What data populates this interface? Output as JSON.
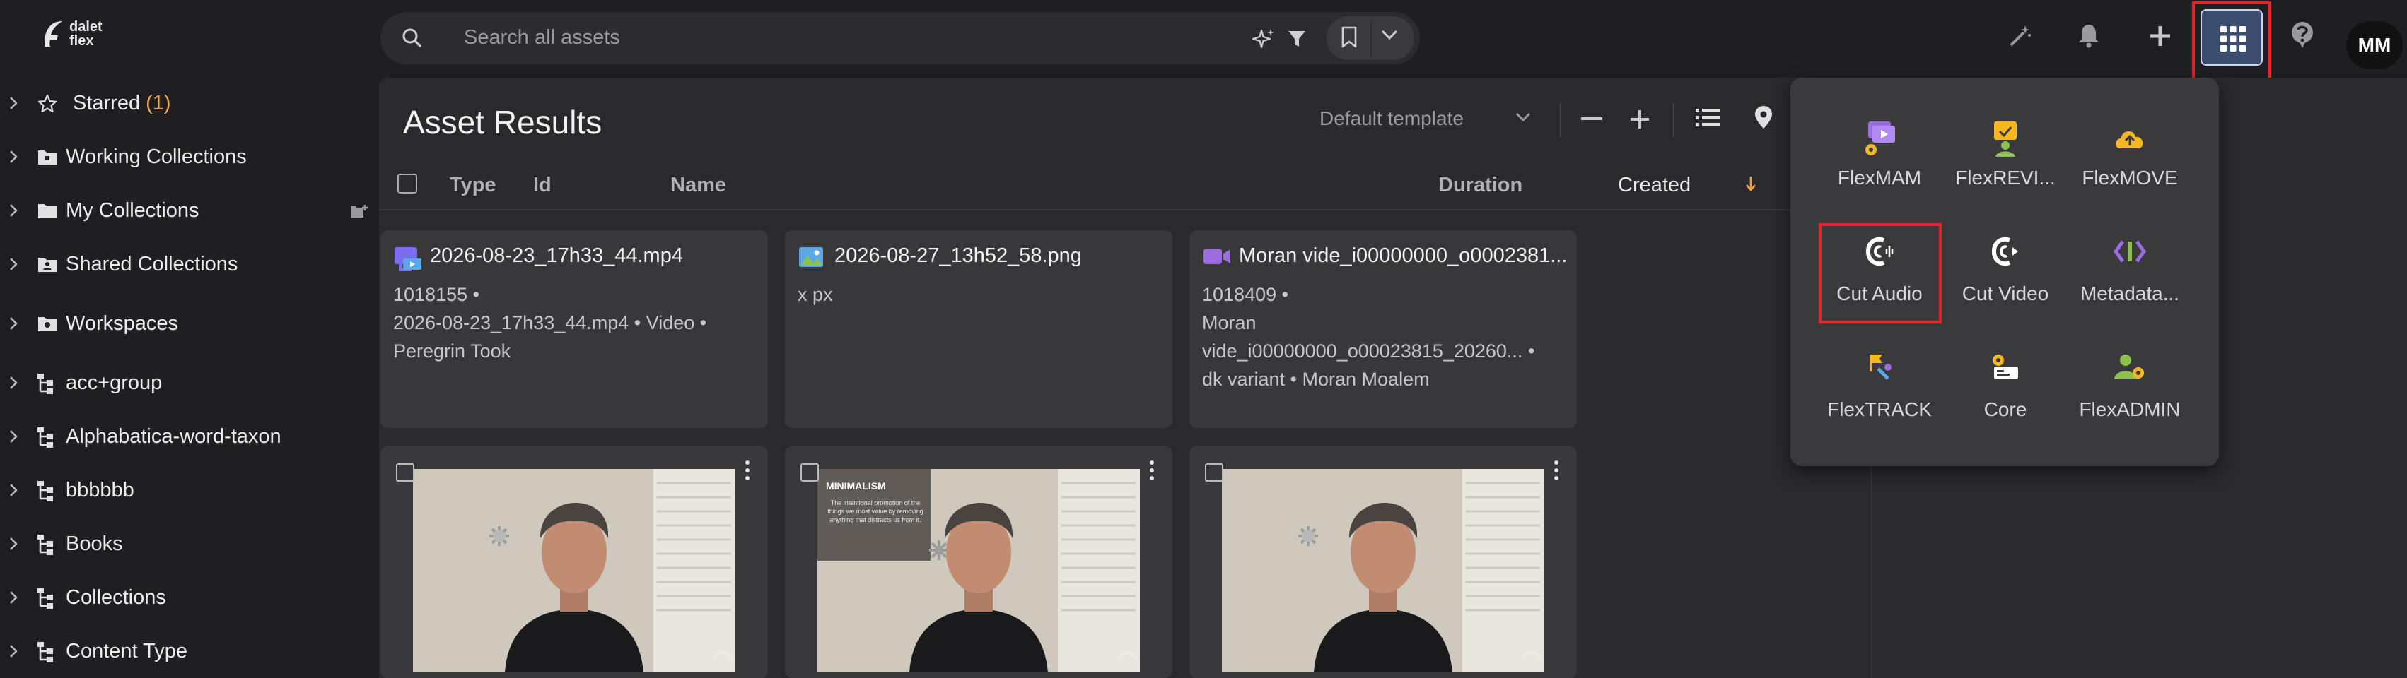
{
  "brand": {
    "logo_line1": "dalet",
    "logo_line2": "flex"
  },
  "sidebar": {
    "items": [
      {
        "label": "Starred",
        "count": "(1)"
      },
      {
        "label": "Working Collections"
      },
      {
        "label": "My Collections"
      },
      {
        "label": "Shared Collections"
      },
      {
        "label": "Workspaces"
      },
      {
        "label": "acc+group"
      },
      {
        "label": "Alphabatica-word-taxon"
      },
      {
        "label": "bbbbbb"
      },
      {
        "label": "Books"
      },
      {
        "label": "Collections"
      },
      {
        "label": "Content Type"
      }
    ]
  },
  "search": {
    "placeholder": "Search all assets"
  },
  "header": {
    "avatar_initials": "MM"
  },
  "main": {
    "title": "Asset Results",
    "template": "Default template",
    "columns": {
      "type": "Type",
      "id": "Id",
      "name": "Name",
      "duration": "Duration",
      "created": "Created"
    }
  },
  "cards": [
    {
      "title": "2026-08-23_17h33_44.mp4",
      "lines": [
        "1018155  •",
        "2026-08-23_17h33_44.mp4  •  Video  •",
        "Peregrin Took"
      ]
    },
    {
      "title": "2026-08-27_13h52_58.png",
      "lines": [
        "x px"
      ]
    },
    {
      "title": "Moran vide_i00000000_o0002381...",
      "lines": [
        "1018409  •",
        "Moran",
        "vide_i00000000_o00023815_20260...  •",
        "dk variant  •  Moran Moalem"
      ]
    }
  ],
  "thumbs": [
    {
      "overlay_title": "",
      "overlay_text": ""
    },
    {
      "overlay_title": "MINIMALISM",
      "overlay_text": "The intentional promotion of the things we most value by removing anything that distracts us from it."
    },
    {
      "overlay_title": "",
      "overlay_text": ""
    }
  ],
  "apps_menu": {
    "apps": [
      {
        "label": "FlexMAM",
        "icon": "flexmam-icon",
        "color": "#9b6ee0"
      },
      {
        "label": "FlexREVI...",
        "icon": "flexreview-icon",
        "color": "#8bc34a"
      },
      {
        "label": "FlexMOVE",
        "icon": "flexmove-icon",
        "color": "#f5b820"
      },
      {
        "label": "Cut Audio",
        "icon": "cut-audio-icon",
        "color": "#ffffff"
      },
      {
        "label": "Cut Video",
        "icon": "cut-video-icon",
        "color": "#ffffff"
      },
      {
        "label": "Metadata...",
        "icon": "metadata-icon",
        "color": "#9b6ee0"
      },
      {
        "label": "FlexTRACK",
        "icon": "flextrack-icon",
        "color": "#f5b820"
      },
      {
        "label": "Core",
        "icon": "core-icon",
        "color": "#f5b820"
      },
      {
        "label": "FlexADMIN",
        "icon": "flexadmin-icon",
        "color": "#8bc34a"
      }
    ]
  },
  "colors": {
    "accent_orange": "#f0a24a",
    "highlight_red": "#e8232a",
    "apps_active": "#3b4c6e"
  }
}
